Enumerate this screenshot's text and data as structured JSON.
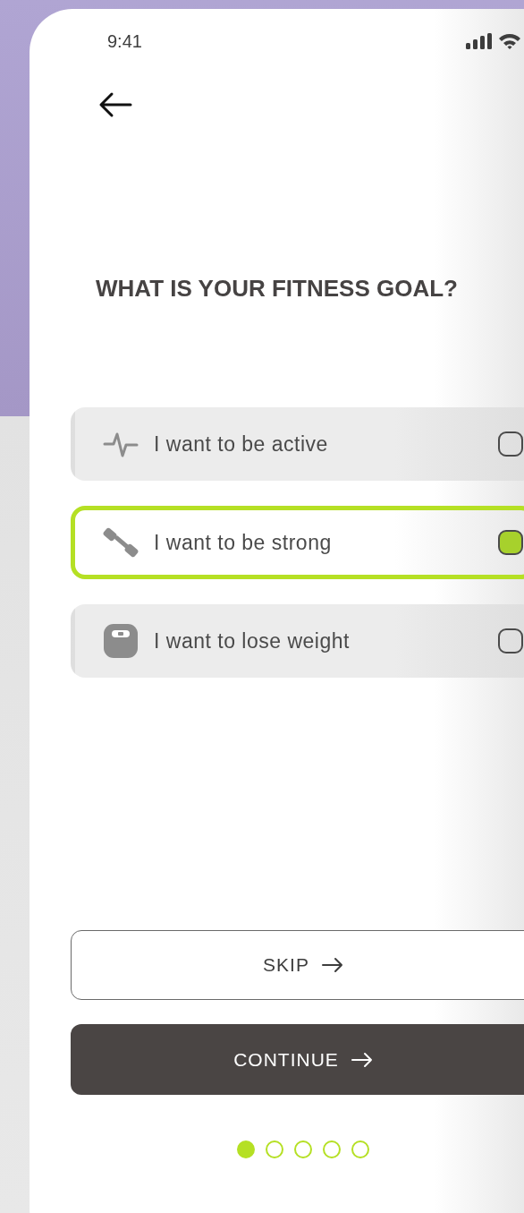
{
  "status_bar": {
    "time": "9:41"
  },
  "title": "WHAT IS YOUR FITNESS GOAL?",
  "options": [
    {
      "kind": "pulse",
      "label": "I want to be active",
      "selected": false
    },
    {
      "kind": "dumbbell",
      "label": "I want to be strong",
      "selected": true
    },
    {
      "kind": "scale",
      "label": "I want to lose weight",
      "selected": false
    }
  ],
  "buttons": [
    {
      "kind": "outline",
      "label": "SKIP"
    },
    {
      "kind": "filled",
      "label": "CONTINUE"
    }
  ],
  "page_indicator": [
    {
      "selected": true
    },
    {
      "selected": false
    },
    {
      "selected": false
    },
    {
      "selected": false
    },
    {
      "selected": false
    }
  ]
}
